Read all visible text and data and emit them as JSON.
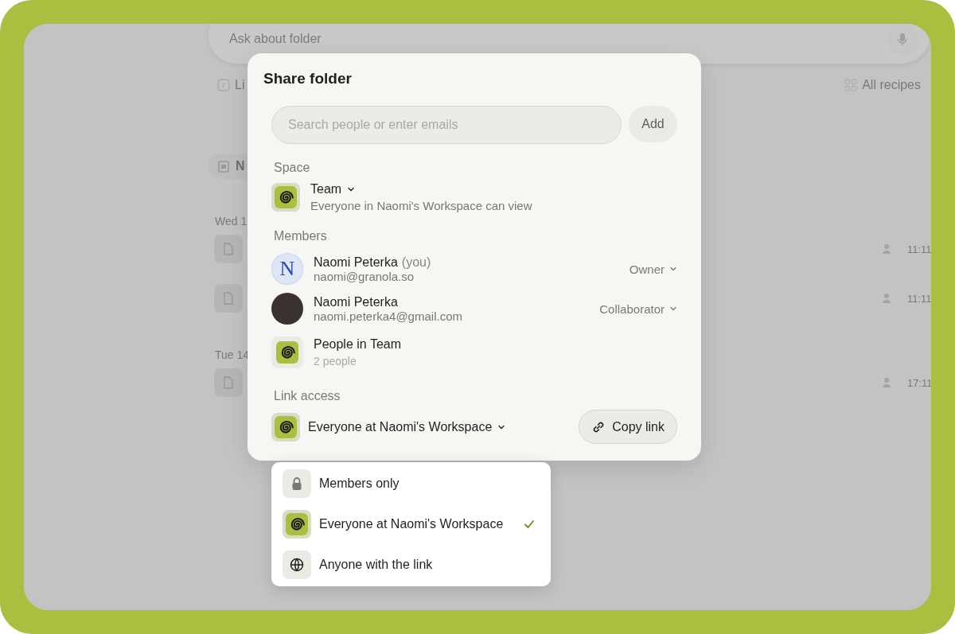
{
  "background": {
    "ask_bar": {
      "placeholder": "Ask about folder"
    },
    "toolbar": {
      "left_label": "Li",
      "right_label": "All recipes"
    },
    "chip": {
      "label": "N"
    },
    "groups": [
      {
        "date": "Wed 1",
        "notes": [
          {
            "time": "11:11"
          },
          {
            "time": "11:11"
          }
        ]
      },
      {
        "date": "Tue 14",
        "notes": [
          {
            "time": "17:11"
          }
        ]
      }
    ]
  },
  "dialog": {
    "title": "Share folder",
    "search": {
      "placeholder": "Search people or enter emails"
    },
    "add_button": "Add",
    "space": {
      "label": "Space",
      "name": "Team",
      "description": "Everyone in Naomi's Workspace can view"
    },
    "members": {
      "label": "Members",
      "items": [
        {
          "kind": "person",
          "initial": "N",
          "name": "Naomi Peterka",
          "note": "(you)",
          "email": "naomi@granola.so",
          "role": "Owner"
        },
        {
          "kind": "person",
          "name": "Naomi Peterka",
          "email": "naomi.peterka4@gmail.com",
          "role": "Collaborator"
        },
        {
          "kind": "group",
          "name": "People in Team",
          "count": "2 people"
        }
      ]
    },
    "link_access": {
      "label": "Link access",
      "value": "Everyone at Naomi's Workspace",
      "copy_button": "Copy link",
      "expanded": true,
      "options": [
        {
          "label": "Members only",
          "selected": false
        },
        {
          "label": "Everyone at Naomi's Workspace",
          "selected": true
        },
        {
          "label": "Anyone with the link",
          "selected": false
        }
      ]
    }
  }
}
